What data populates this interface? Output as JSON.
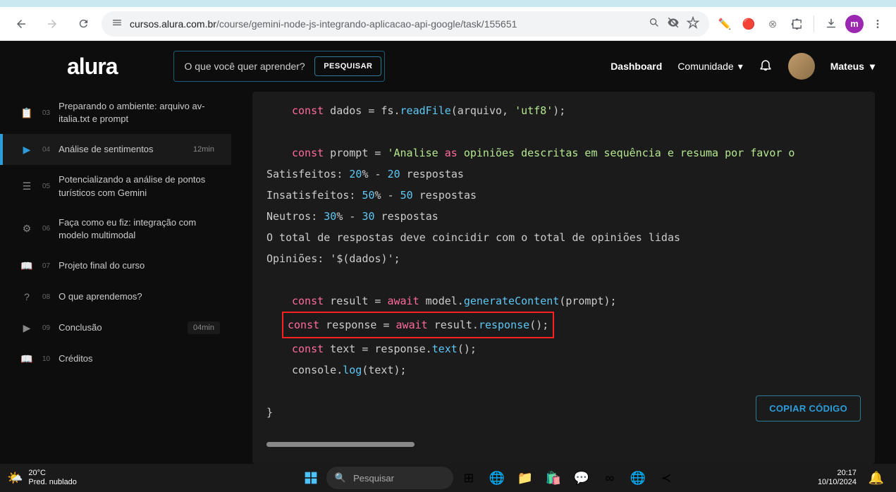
{
  "browser": {
    "url_domain": "cursos.alura.com.br",
    "url_path": "/course/gemini-node-js-integrando-aplicacao-api-google/task/155651"
  },
  "header": {
    "logo": "alura",
    "search_placeholder": "O que você quer aprender?",
    "search_button": "PESQUISAR",
    "dashboard": "Dashboard",
    "community": "Comunidade",
    "username": "Mateus"
  },
  "sidebar": {
    "items": [
      {
        "num": "03",
        "label": "Preparando o ambiente: arquivo av-italia.txt e prompt",
        "time": ""
      },
      {
        "num": "04",
        "label": "Análise de sentimentos",
        "time": "12min"
      },
      {
        "num": "05",
        "label": "Potencializando a análise de pontos turísticos com Gemini",
        "time": ""
      },
      {
        "num": "06",
        "label": "Faça como eu fiz: integração com modelo multimodal",
        "time": ""
      },
      {
        "num": "07",
        "label": "Projeto final do curso",
        "time": ""
      },
      {
        "num": "08",
        "label": "O que aprendemos?",
        "time": ""
      },
      {
        "num": "09",
        "label": "Conclusão",
        "time": "04min"
      },
      {
        "num": "10",
        "label": "Créditos",
        "time": ""
      }
    ]
  },
  "code": {
    "line1_const": "const",
    "line1_var": " dados = fs.",
    "line1_fn": "readFile",
    "line1_args": "(arquivo, ",
    "line1_str": "'utf8'",
    "line1_end": ");",
    "line2_const": "const",
    "line2_var": " prompt = ",
    "line2_str1": "'Analise ",
    "line2_as": "as",
    "line2_str2": " opiniões descritas em sequência e resuma por favor o",
    "line3": "Satisfeitos: ",
    "line3_n1": "20",
    "line3_mid": "% - ",
    "line3_n2": "20",
    "line3_rest": " respostas",
    "line4": "Insatisfeitos: ",
    "line4_n1": "50",
    "line4_mid": "% - ",
    "line4_n2": "50",
    "line4_rest": " respostas",
    "line5": "Neutros: ",
    "line5_n1": "30",
    "line5_mid": "% - ",
    "line5_n2": "30",
    "line5_rest": " respostas",
    "line6": "O total de respostas deve coincidir com o total de opiniões lidas",
    "line7": "Opiniões: '$(dados)';",
    "line8_const": "const",
    "line8_var": " result = ",
    "line8_await": "await",
    "line8_mid": " model.",
    "line8_fn": "generateContent",
    "line8_end": "(prompt);",
    "line9_const": "const",
    "line9_var": " response = ",
    "line9_await": "await",
    "line9_mid": " result.",
    "line9_fn": "response",
    "line9_end": "();",
    "line10_const": "const",
    "line10_var": " text = response.",
    "line10_fn": "text",
    "line10_end": "();",
    "line11_pre": "console.",
    "line11_fn": "log",
    "line11_end": "(text);",
    "line12": "}",
    "copy_button": "COPIAR CÓDIGO"
  },
  "taskbar": {
    "temp": "20°C",
    "weather": "Pred. nublado",
    "search": "Pesquisar",
    "time": "20:17",
    "date": "10/10/2024"
  }
}
